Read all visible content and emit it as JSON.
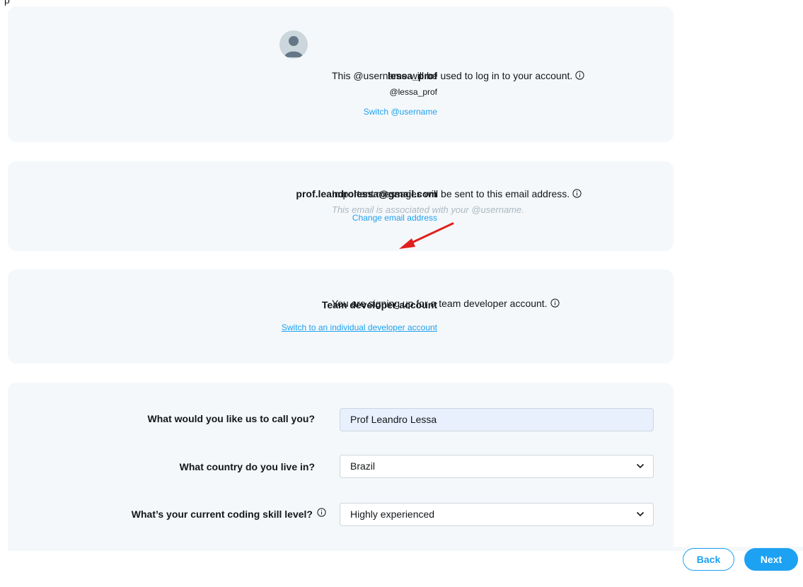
{
  "top_edge_text": "p",
  "account": {
    "display_name": "lessa_prof",
    "handle": "@lessa_prof",
    "switch_label": "Switch @username",
    "description": "This @username will be used to log in to your account."
  },
  "email": {
    "address": "prof.leandrolessa@gmail.com",
    "change_label": "Change email address",
    "description": "Important messages will be sent to this email address.",
    "note": "This email is associated with your @username."
  },
  "account_type": {
    "title": "Team developer account",
    "switch_label": "Switch to an individual developer account",
    "description": "You are signing up for a team developer account."
  },
  "form": {
    "name_label": "What would you like us to call you?",
    "name_value": "Prof Leandro Lessa",
    "country_label": "What country do you live in?",
    "country_value": "Brazil",
    "skill_label": "What’s your current coding skill level?",
    "skill_value": "Highly experienced"
  },
  "buttons": {
    "back": "Back",
    "next": "Next"
  },
  "icons": {
    "info": "info-circle-icon",
    "avatar": "default-avatar-icon",
    "dropdown": "chevron-down-icon",
    "annotation": "red-arrow-annotation"
  },
  "colors": {
    "accent": "#1da1f2",
    "card_bg": "#f5f8fa",
    "annotation": "#e0201c"
  }
}
